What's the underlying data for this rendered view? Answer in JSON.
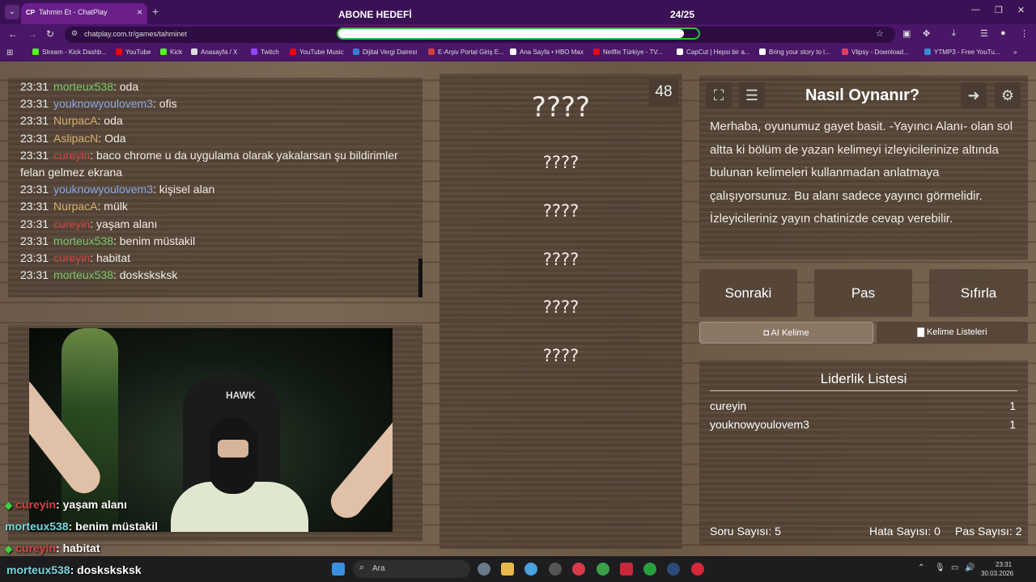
{
  "browser": {
    "tab_title": "Tahmin Et - ChatPlay",
    "tab_favicon": "CP",
    "url": "chatplay.com.tr/games/tahminet",
    "bookmarks": [
      {
        "label": "Stream - Kick Dashb...",
        "color": "#53fc18"
      },
      {
        "label": "YouTube",
        "color": "#ff0000"
      },
      {
        "label": "Kick",
        "color": "#53fc18"
      },
      {
        "label": "Anasayfa / X",
        "color": "#dddddd"
      },
      {
        "label": "Twitch",
        "color": "#9146ff"
      },
      {
        "label": "YouTube Music",
        "color": "#ff0000"
      },
      {
        "label": "Dijital Vergi Dairesi",
        "color": "#3a7bd5"
      },
      {
        "label": "E-Arşiv Portal Giriş E...",
        "color": "#d04040"
      },
      {
        "label": "Ana Sayfa • HBO Max",
        "color": "#ffffff"
      },
      {
        "label": "Netflix Türkiye - TV...",
        "color": "#e50914"
      },
      {
        "label": "CapCut | Hepsi bir a...",
        "color": "#ffffff"
      },
      {
        "label": "Bring your story to l...",
        "color": "#ffffff"
      },
      {
        "label": "Vlipsy - Download...",
        "color": "#e04060"
      },
      {
        "label": "YTMP3 - Free YouTu...",
        "color": "#3a8ad8"
      }
    ]
  },
  "subscriber_goal": {
    "label": "ABONE HEDEFİ",
    "count": "24/25",
    "progress": 0.96
  },
  "chat": {
    "messages": [
      {
        "time": "23:31",
        "user": "morteux538",
        "color": "green",
        "text": ": oda"
      },
      {
        "time": "23:31",
        "user": "youknowyoulovem3",
        "color": "blue",
        "text": ": ofis"
      },
      {
        "time": "23:31",
        "user": "NurpacA",
        "color": "tan",
        "text": ": oda"
      },
      {
        "time": "23:31",
        "user": "AslipacN",
        "color": "tan",
        "text": ": Oda"
      },
      {
        "time": "23:31",
        "user": "cureyin",
        "color": "red",
        "text": ": baco chrome u da uygulama olarak yakalarsan şu bildirimler felan gelmez ekrana"
      },
      {
        "time": "23:31",
        "user": "youknowyoulovem3",
        "color": "blue",
        "text": ": kişisel alan"
      },
      {
        "time": "23:31",
        "user": "NurpacA",
        "color": "tan",
        "text": ": mülk"
      },
      {
        "time": "23:31",
        "user": "cureyin",
        "color": "red",
        "text": ": yaşam alanı"
      },
      {
        "time": "23:31",
        "user": "morteux538",
        "color": "green",
        "text": ": benim müstakil"
      },
      {
        "time": "23:31",
        "user": "cureyin",
        "color": "red",
        "text": ": habitat"
      },
      {
        "time": "23:31",
        "user": "morteux538",
        "color": "green",
        "text": ": dosksksksk"
      }
    ]
  },
  "webcam": {
    "chair_brand": "HAWK"
  },
  "overlay_chat": [
    {
      "user": "cureyin",
      "text": ": yaşam alanı",
      "badge": true,
      "color": "#d04545"
    },
    {
      "user": "morteux538",
      "text": ": benim müstakil",
      "badge": false,
      "color": "#78d8e0"
    },
    {
      "user": "cureyin",
      "text": ": habitat",
      "badge": true,
      "color": "#d04545"
    },
    {
      "user": "morteux538",
      "text": ": dosksksksk",
      "badge": false,
      "color": "#78d8e0"
    }
  ],
  "game": {
    "timer": "48",
    "main_word": "????",
    "forbidden_words": [
      "????",
      "????",
      "????",
      "????",
      "????"
    ]
  },
  "how_to": {
    "title": "Nasıl Oynanır?",
    "text": "Merhaba, oyunumuz gayet basit. -Yayıncı Alanı- olan sol altta ki bölüm de yazan kelimeyi izleyicilerinize altında bulunan kelimeleri kullanmadan anlatmaya çalışıyorsunuz. Bu alanı sadece yayıncı görmelidir. İzleyicileriniz yayın chatinizde cevap verebilir."
  },
  "actions": {
    "next": "Sonraki",
    "pass": "Pas",
    "reset": "Sıfırla",
    "ai_word": "AI Kelime",
    "word_lists": "Kelime Listeleri"
  },
  "leaderboard": {
    "title": "Liderlik Listesi",
    "rows": [
      {
        "name": "cureyin",
        "score": "1"
      },
      {
        "name": "youknowyoulovem3",
        "score": "1"
      }
    ],
    "stats": {
      "questions": "Soru Sayısı: 5",
      "errors": "Hata Sayısı: 0",
      "passes": "Pas Sayısı: 2"
    }
  },
  "taskbar": {
    "search_placeholder": "Ara",
    "time": "23:31",
    "date": "30.03.2026"
  }
}
